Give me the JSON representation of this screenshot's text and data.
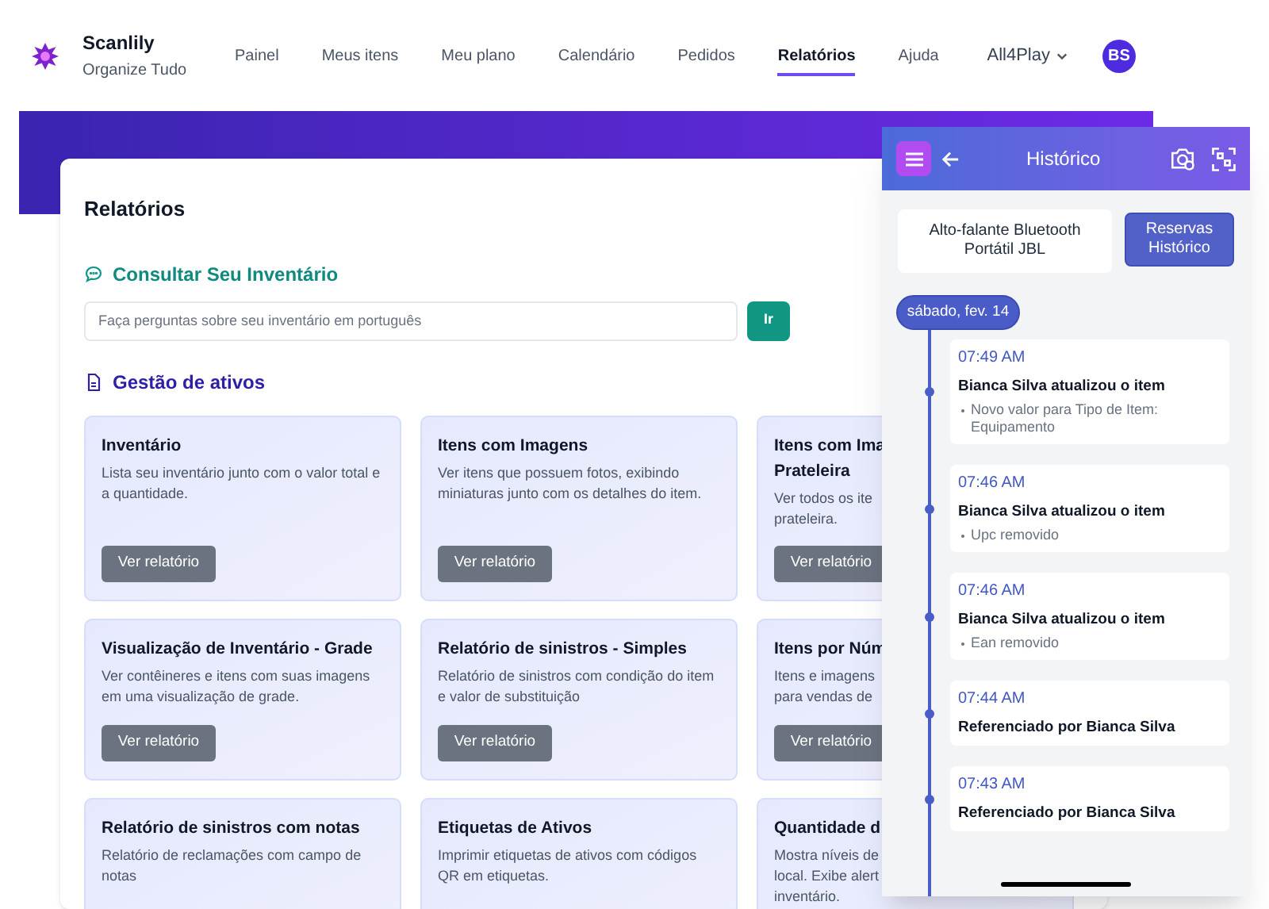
{
  "brand": {
    "name": "Scanlily",
    "tagline": "Organize Tudo"
  },
  "nav": [
    {
      "label": "Painel",
      "selected": false
    },
    {
      "label": "Meus itens",
      "selected": false
    },
    {
      "label": "Meu plano",
      "selected": false
    },
    {
      "label": "Calendário",
      "selected": false
    },
    {
      "label": "Pedidos",
      "selected": false
    },
    {
      "label": "Relatórios",
      "selected": true
    },
    {
      "label": "Ajuda",
      "selected": false
    }
  ],
  "account": {
    "name": "All4Play",
    "initials": "BS"
  },
  "page": {
    "title": "Relatórios",
    "query": {
      "heading": "Consultar Seu Inventário",
      "placeholder": "Faça perguntas sobre seu inventário em português",
      "button": "Ir"
    },
    "section": "Gestão de ativos",
    "cards": [
      {
        "title": [
          "Inventário"
        ],
        "description": [
          "Lista seu inventário junto com o valor total e a quantidade."
        ],
        "button": "Ver relatório"
      },
      {
        "title": [
          "Itens com Imagens"
        ],
        "description": [
          "Ver itens que possuem fotos, exibindo miniaturas junto com os detalhes do item."
        ],
        "button": "Ver relatório"
      },
      {
        "title": [
          "Itens com Ima",
          "Prateleira"
        ],
        "description": [
          "Ver todos os ite",
          "prateleira."
        ],
        "button": "Ver relatório"
      },
      {
        "title": [
          "Visualização de Inventário - Grade"
        ],
        "description": [
          "Ver contêineres e itens com suas imagens em uma visualização de grade."
        ],
        "button": "Ver relatório"
      },
      {
        "title": [
          "Relatório de sinistros - Simples"
        ],
        "description": [
          "Relatório de sinistros com condição do item e valor de substituição"
        ],
        "button": "Ver relatório"
      },
      {
        "title": [
          "Itens por Núm"
        ],
        "description": [
          "Itens e imagens",
          "para vendas de"
        ],
        "button": "Ver relatório"
      },
      {
        "title": [
          "Relatório de sinistros com notas"
        ],
        "description": [
          "Relatório de reclamações com campo de notas"
        ]
      },
      {
        "title": [
          "Etiquetas de Ativos"
        ],
        "description": [
          "Imprimir etiquetas de ativos com códigos QR em etiquetas."
        ]
      },
      {
        "title": [
          "Quantidade d"
        ],
        "description": [
          "Mostra níveis de",
          "local. Exibe alert",
          "inventário."
        ]
      }
    ]
  },
  "phone": {
    "title": "Histórico",
    "item": "Alto-falante Bluetooth Portátil JBL",
    "history_button": "Reservas Histórico",
    "date": "sábado, fev. 14",
    "entries": [
      {
        "time": "07:49 AM",
        "text": "Bianca Silva atualizou o item",
        "details": [
          "Novo valor para Tipo de Item: Equipamento"
        ]
      },
      {
        "time": "07:46 AM",
        "text": "Bianca Silva atualizou o item",
        "details": [
          "Upc removido"
        ]
      },
      {
        "time": "07:46 AM",
        "text": "Bianca Silva atualizou o item",
        "details": [
          "Ean removido"
        ]
      },
      {
        "time": "07:44 AM",
        "text": "Referenciado por Bianca Silva"
      },
      {
        "time": "07:43 AM",
        "text": "Referenciado por Bianca Silva"
      }
    ]
  }
}
